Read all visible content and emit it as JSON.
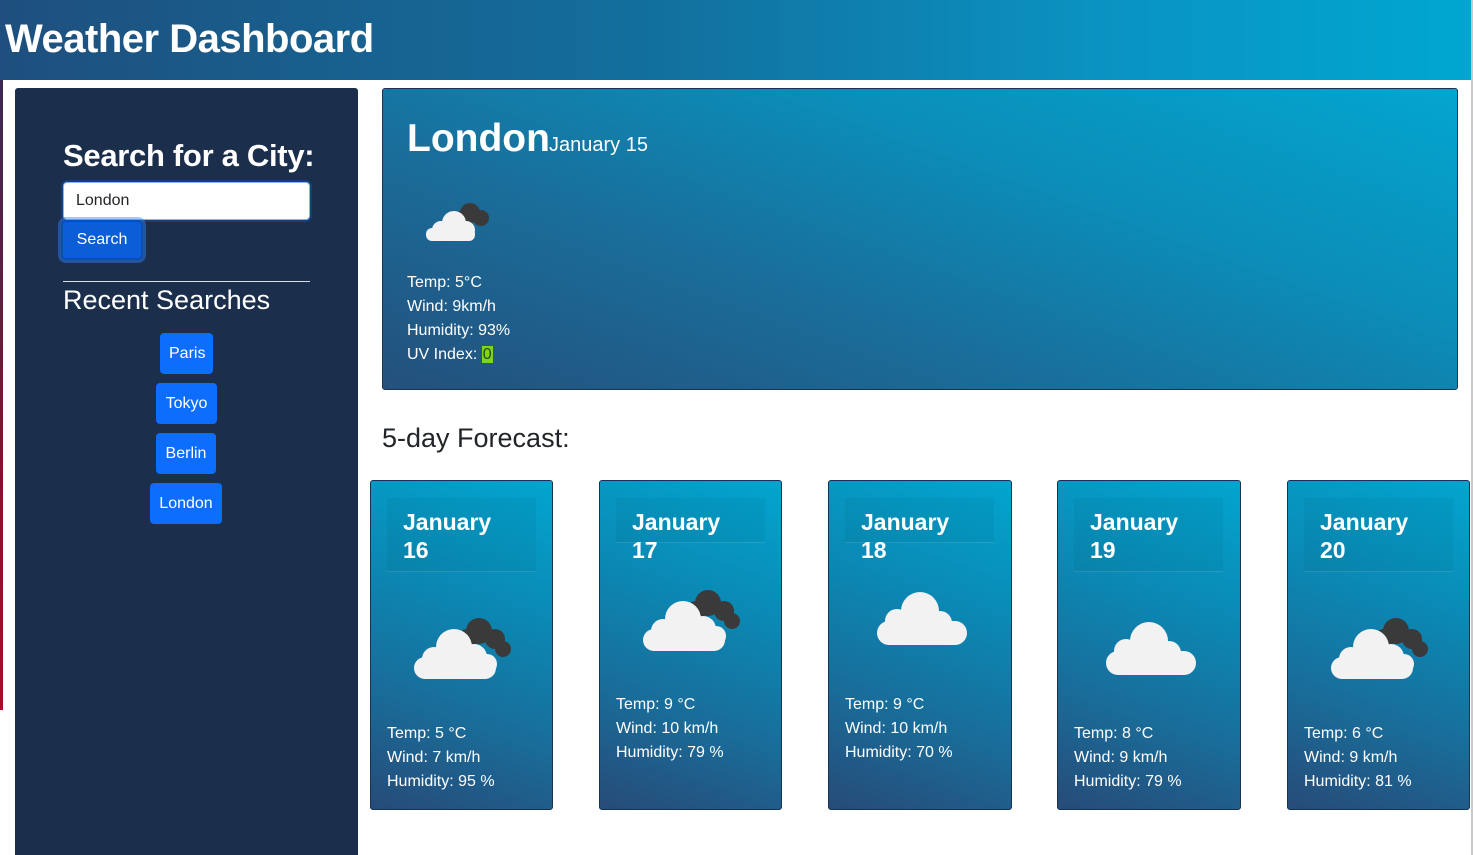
{
  "header": {
    "title": "Weather Dashboard"
  },
  "search": {
    "title": "Search for a City:",
    "input_value": "London",
    "button_label": "Search"
  },
  "recent": {
    "title": "Recent Searches",
    "items": [
      {
        "label": "Paris"
      },
      {
        "label": "Tokyo"
      },
      {
        "label": "Berlin"
      },
      {
        "label": "London"
      }
    ]
  },
  "current": {
    "city": "London",
    "date": "January 15",
    "icon": "partly-cloudy-icon",
    "temp": "Temp: 5°C",
    "wind": "Wind: 9km/h",
    "humidity": "Humidity: 93%",
    "uv_label": "UV Index: ",
    "uv_value": "0"
  },
  "forecast": {
    "title": "5-day Forecast:",
    "days": [
      {
        "date": "January 16",
        "icon": "broken-clouds-icon",
        "temp": "Temp: 5 °C",
        "wind": "Wind: 7 km/h",
        "humidity": "Humidity: 95 %"
      },
      {
        "date": "January 17",
        "icon": "broken-clouds-icon",
        "temp": "Temp: 9 °C",
        "wind": "Wind: 10 km/h",
        "humidity": "Humidity: 79 %"
      },
      {
        "date": "January 18",
        "icon": "cloud-icon",
        "temp": "Temp: 9 °C",
        "wind": "Wind: 10 km/h",
        "humidity": "Humidity: 70 %"
      },
      {
        "date": "January 19",
        "icon": "cloud-icon",
        "temp": "Temp: 8 °C",
        "wind": "Wind: 9 km/h",
        "humidity": "Humidity: 79 %"
      },
      {
        "date": "January 20",
        "icon": "broken-clouds-icon",
        "temp": "Temp: 6 °C",
        "wind": "Wind: 9 km/h",
        "humidity": "Humidity: 81 %"
      }
    ]
  },
  "colors": {
    "header_start": "#1e4f7e",
    "header_end": "#00a7d1",
    "sidebar_bg": "#1b2e4b",
    "button_blue": "#0d6efd",
    "uv_low": "#7ed321"
  }
}
